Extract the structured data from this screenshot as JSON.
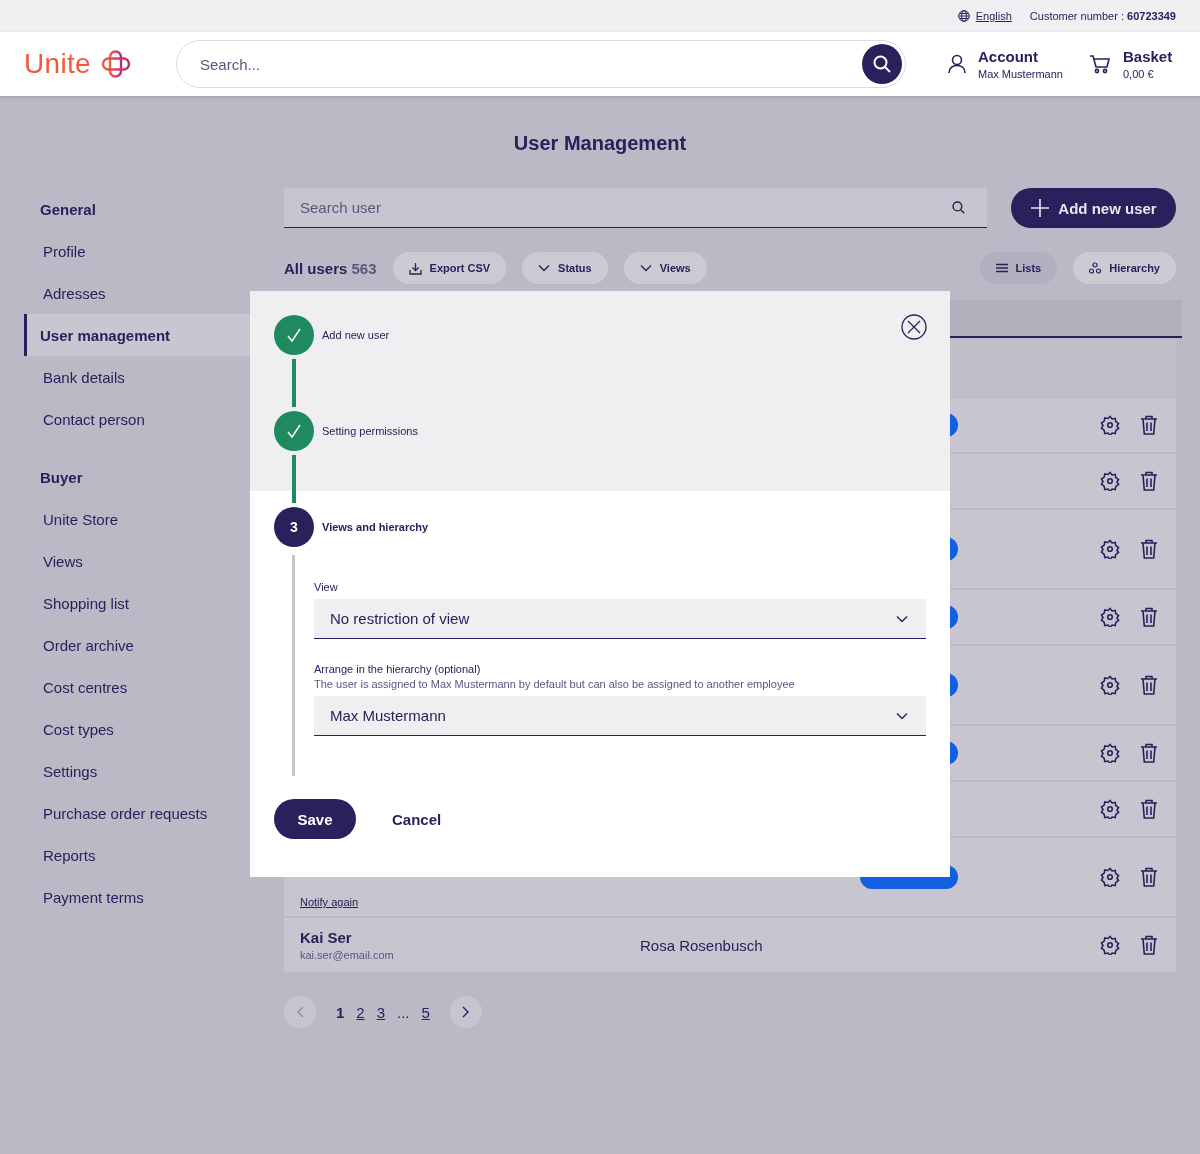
{
  "top_bar": {
    "language": "English",
    "customer_label": "Customer number :",
    "customer_number": "60723349"
  },
  "header": {
    "logo": "Unite",
    "search": {
      "placeholder": "Search..."
    },
    "account": {
      "label": "Account",
      "name": "Max Mustermann"
    },
    "basket": {
      "label": "Basket",
      "total": "0,00 €"
    }
  },
  "page_title": "User Management",
  "sidebar": {
    "sections": [
      {
        "heading": "General",
        "items": [
          {
            "label": "Profile",
            "selected": false
          },
          {
            "label": "Adresses",
            "selected": false
          },
          {
            "label": "User management",
            "selected": true
          },
          {
            "label": "Bank details",
            "selected": false
          },
          {
            "label": "Contact person",
            "selected": false
          }
        ]
      },
      {
        "heading": "Buyer",
        "items": [
          {
            "label": "Unite Store",
            "selected": false
          },
          {
            "label": "Views",
            "selected": false
          },
          {
            "label": "Shopping list",
            "selected": false
          },
          {
            "label": "Order archive",
            "selected": false
          },
          {
            "label": "Cost centres",
            "selected": false
          },
          {
            "label": "Cost types",
            "selected": false
          },
          {
            "label": "Settings",
            "selected": false
          },
          {
            "label": "Purchase order requests",
            "selected": false
          },
          {
            "label": "Reports",
            "selected": false
          },
          {
            "label": "Payment terms",
            "selected": false
          }
        ]
      }
    ]
  },
  "toolbar": {
    "search": {
      "placeholder": "Search user"
    },
    "add_button": "Add new user",
    "count_label": "All users",
    "count": "563",
    "actions": [
      {
        "label": "Export CSV",
        "kind": "export"
      },
      {
        "label": "Status",
        "kind": "dropdown"
      },
      {
        "label": "Views",
        "kind": "dropdown"
      }
    ],
    "view_toggles": [
      {
        "label": "Lists",
        "kind": "lists",
        "selected": true
      },
      {
        "label": "Hierarchy",
        "kind": "hierarchy",
        "selected": false
      }
    ]
  },
  "table": {
    "rows": [
      {
        "kind": "short",
        "badge": true
      },
      {
        "kind": "short",
        "badge": false
      },
      {
        "kind": "tall",
        "badge": true
      },
      {
        "kind": "short",
        "badge": true
      },
      {
        "kind": "tall",
        "badge": true
      },
      {
        "kind": "short",
        "badge": true
      },
      {
        "kind": "short",
        "badge": false
      },
      {
        "kind": "tall",
        "badge": true,
        "notify": "Notify again"
      },
      {
        "kind": "short",
        "badge": false,
        "name": "Kai Ser",
        "email": "kai.ser@email.com",
        "manager": "Rosa Rosenbusch"
      }
    ]
  },
  "pagination": {
    "pages": [
      {
        "label": "1",
        "selected": true
      },
      {
        "label": "2",
        "selected": false
      },
      {
        "label": "3",
        "selected": false
      },
      {
        "label": "...",
        "kind": "gap",
        "selected": false
      },
      {
        "label": "5",
        "selected": false
      }
    ]
  },
  "modal": {
    "steps": [
      {
        "label": "Add new user",
        "done": true
      },
      {
        "label": "Setting permissions",
        "done": true
      },
      {
        "label": "Views and hierarchy",
        "number": "3",
        "done": false
      }
    ],
    "fields": [
      {
        "label": "View",
        "value": "No restriction of view"
      },
      {
        "label": "Arrange in the hierarchy (optional)",
        "hint": "The user is assigned to Max Mustermann by default but can also be assigned to another employee",
        "value": "Max Mustermann"
      }
    ],
    "save": "Save",
    "cancel": "Cancel"
  }
}
